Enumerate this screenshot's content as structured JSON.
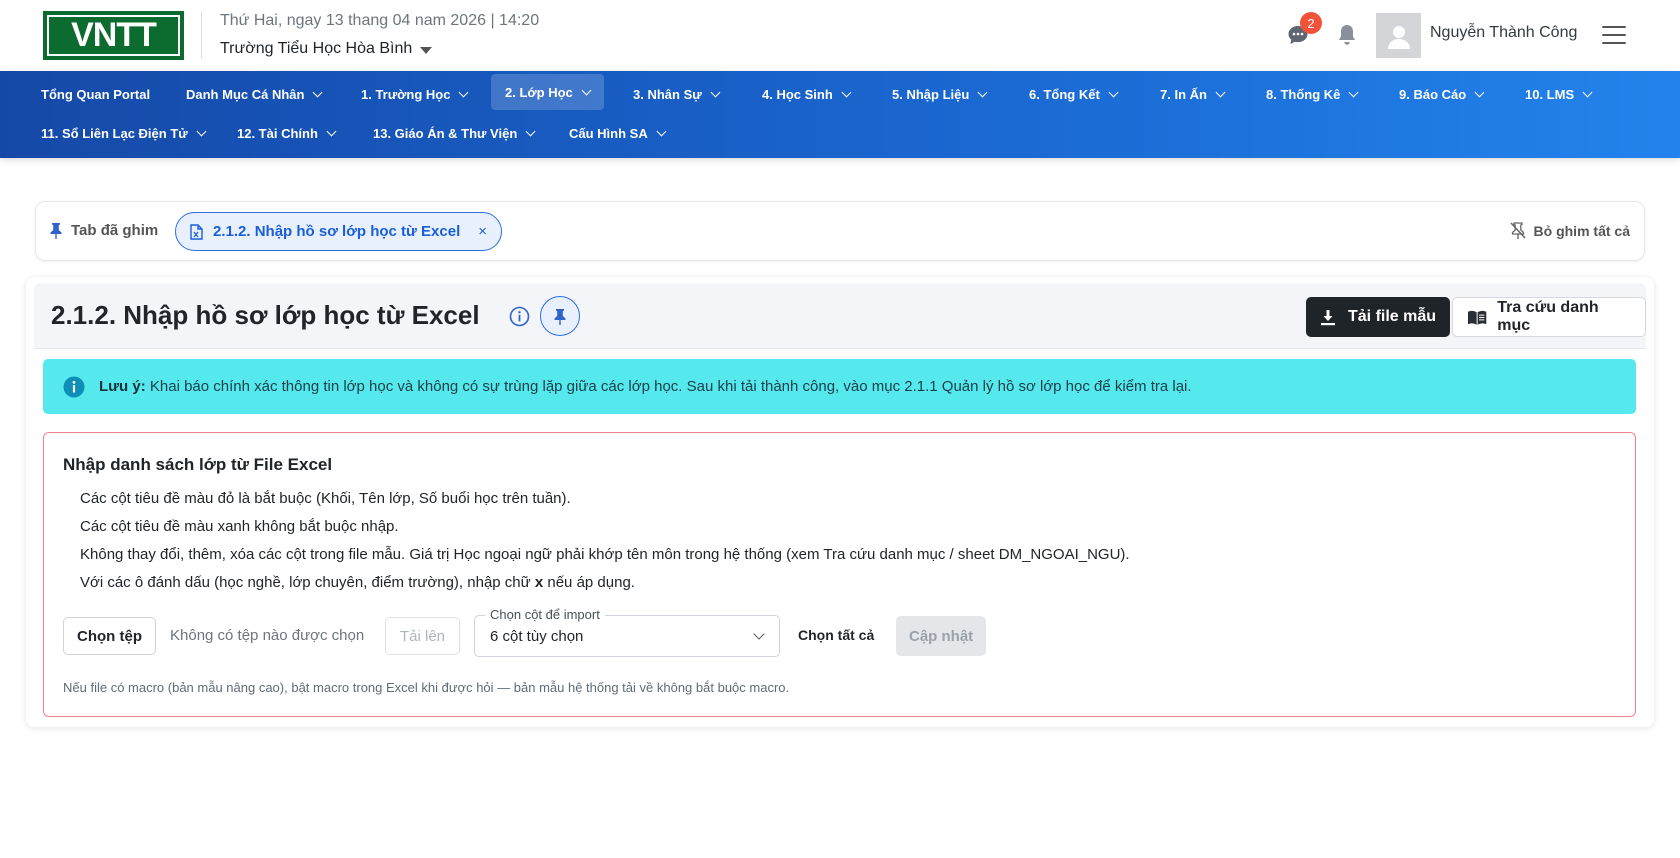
{
  "header": {
    "logo_text": "VNTT",
    "datetime": "Thứ Hai, ngay 13 thang 04 nam 2026 | 14:20",
    "school": "Trường Tiểu Học Hòa Bình",
    "chat_badge": "2",
    "user_name": "Nguyễn Thành Công"
  },
  "nav": {
    "items": [
      {
        "label": "Tổng Quan Portal"
      },
      {
        "label": "Danh Mục Cá Nhân"
      },
      {
        "label": "1. Trường Học"
      },
      {
        "label": "2. Lớp Học"
      },
      {
        "label": "3. Nhân Sự"
      },
      {
        "label": "4. Học Sinh"
      },
      {
        "label": "5. Nhập Liệu"
      },
      {
        "label": "6. Tổng Kết"
      },
      {
        "label": "7. In Ấn"
      },
      {
        "label": "8. Thống Kê"
      },
      {
        "label": "9. Báo Cáo"
      },
      {
        "label": "10. LMS"
      },
      {
        "label": "11. Sổ Liên Lạc Điện Tử"
      },
      {
        "label": "12. Tài Chính"
      },
      {
        "label": "13. Giáo Án & Thư Viện"
      },
      {
        "label": "Cấu Hình SA"
      }
    ]
  },
  "pinned": {
    "label": "Tab đã ghim",
    "chip_label": "2.1.2. Nhập hồ sơ lớp học từ Excel",
    "close_symbol": "×",
    "unpin_all": "Bỏ ghim tất cả"
  },
  "page": {
    "title": "2.1.2. Nhập hồ sơ lớp học từ Excel",
    "download_template": "Tải file mẫu",
    "lookup_catalog": "Tra cứu danh mục"
  },
  "alert": {
    "prefix": "Lưu ý:",
    "text": "Khai báo chính xác thông tin lớp học và không có sự trùng lặp giữa các lớp học. Sau khi tải thành công, vào mục 2.1.1 Quản lý hồ sơ lớp học để kiểm tra lại."
  },
  "import": {
    "title": "Nhập danh sách lớp từ File Excel",
    "rules": [
      "Các cột tiêu đề màu đỏ là bắt buộc (Khối, Tên lớp, Số buổi học trên tuần).",
      "Các cột tiêu đề màu xanh không bắt buộc nhập.",
      "Không thay đổi, thêm, xóa các cột trong file mẫu. Giá trị Học ngoại ngữ phải khớp tên môn trong hệ thống (xem Tra cứu danh mục / sheet DM_NGOAI_NGU)."
    ],
    "rule4_before": "Với các ô đánh dấu (học nghề, lớp chuyên, điểm trường), nhập chữ",
    "rule4_mark": "x",
    "rule4_after": "nếu áp dụng.",
    "choose_file": "Chọn tệp",
    "no_file": "Không có tệp nào được chọn",
    "upload": "Tải lên",
    "select_legend": "Chọn cột để import",
    "select_value": "6 cột tùy chọn",
    "select_all": "Chọn tất cả",
    "update": "Cập nhật",
    "footnote": "Nếu file có macro (bản mẫu nâng cao), bật macro trong Excel khi được hỏi — bản mẫu hệ thống tải về không bắt buộc macro."
  }
}
